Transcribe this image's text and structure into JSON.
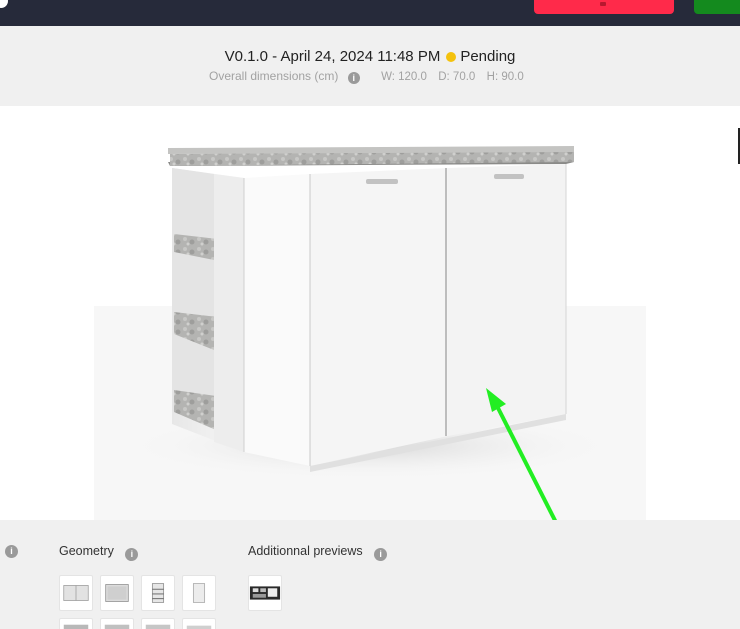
{
  "topbar": {
    "primary_button_label": "",
    "secondary_button_label": ""
  },
  "header": {
    "version": "V0.1.0",
    "separator": " - ",
    "date": "April 24, 2024 11:48 PM",
    "status": "Pending",
    "status_color": "#f4c20d",
    "dimensions_label": "Overall dimensions (cm)",
    "width": "W: 120.0",
    "depth": "D: 70.0",
    "height": "H: 90.0"
  },
  "sections": {
    "geometry": {
      "title": "Geometry"
    },
    "previews": {
      "title": "Additionnal previews"
    }
  },
  "icons": {
    "info": "i"
  },
  "colors": {
    "topbar": "#262a3a",
    "danger": "#ff2a4a",
    "success": "#148a1e",
    "annotation_arrow": "#22ee22"
  }
}
